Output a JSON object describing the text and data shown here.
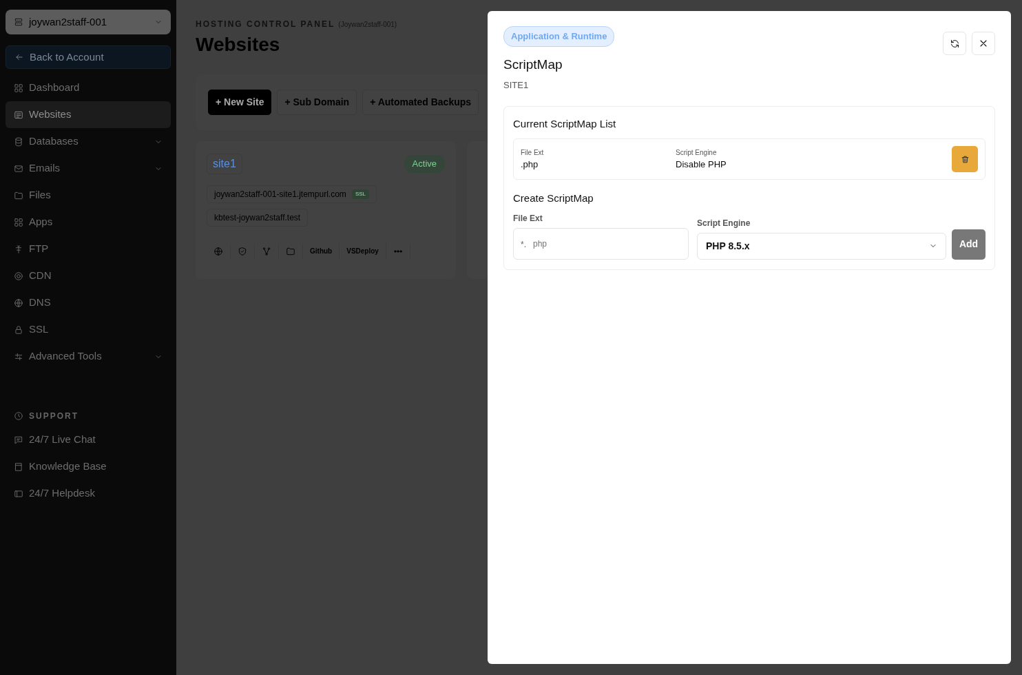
{
  "sidebar": {
    "account_selector": "joywan2staff-001",
    "back_link": "Back to Account",
    "items": [
      {
        "label": "Dashboard",
        "selected": false,
        "has_submenu": false
      },
      {
        "label": "Websites",
        "selected": true,
        "has_submenu": false
      },
      {
        "label": "Databases",
        "selected": false,
        "has_submenu": true
      },
      {
        "label": "Emails",
        "selected": false,
        "has_submenu": true
      },
      {
        "label": "Files",
        "selected": false,
        "has_submenu": false
      },
      {
        "label": "Apps",
        "selected": false,
        "has_submenu": false
      },
      {
        "label": "FTP",
        "selected": false,
        "has_submenu": false
      },
      {
        "label": "CDN",
        "selected": false,
        "has_submenu": false
      },
      {
        "label": "DNS",
        "selected": false,
        "has_submenu": false
      },
      {
        "label": "SSL",
        "selected": false,
        "has_submenu": false
      },
      {
        "label": "Advanced Tools",
        "selected": false,
        "has_submenu": true
      }
    ],
    "support_heading": "SUPPORT",
    "support_items": [
      {
        "label": "24/7 Live Chat"
      },
      {
        "label": "Knowledge Base"
      },
      {
        "label": "24/7 Helpdesk"
      }
    ]
  },
  "main": {
    "eyebrow": "HOSTING CONTROL PANEL",
    "eyebrow_account": "(Joywan2staff-001)",
    "title": "Websites",
    "toolbar": [
      {
        "label": "+ New Site",
        "primary": true
      },
      {
        "label": "+ Sub Domain",
        "primary": false
      },
      {
        "label": "+ Automated Backups",
        "primary": false
      }
    ],
    "sites": [
      {
        "name": "site1",
        "status": "Active",
        "domains": [
          {
            "host": "joywan2staff-001-site1.jtempurl.com",
            "ssl_badge": "SSL"
          },
          {
            "host": "kbtest-joywan2staff.test"
          }
        ],
        "actions": [
          {
            "kind": "icon"
          },
          {
            "kind": "icon"
          },
          {
            "kind": "icon"
          },
          {
            "kind": "icon"
          },
          {
            "kind": "text",
            "label": "Github"
          },
          {
            "kind": "text",
            "label": "VSDeploy"
          },
          {
            "kind": "more"
          }
        ]
      }
    ]
  },
  "modal": {
    "tag": "Application & Runtime",
    "title": "ScriptMap",
    "subtitle": "SITE1",
    "list_heading": "Current ScriptMap List",
    "entries": [
      {
        "ext_label": "File Ext",
        "ext": ".php",
        "engine_label": "Script Engine",
        "engine": "Disable PHP"
      }
    ],
    "create_heading": "Create ScriptMap",
    "ext_field": {
      "label": "File Ext",
      "prefix": "*.",
      "placeholder": "php"
    },
    "engine_field": {
      "label": "Script Engine",
      "value": "PHP 8.5.x"
    },
    "add_button": {
      "label": "Add",
      "disabled": true
    }
  }
}
